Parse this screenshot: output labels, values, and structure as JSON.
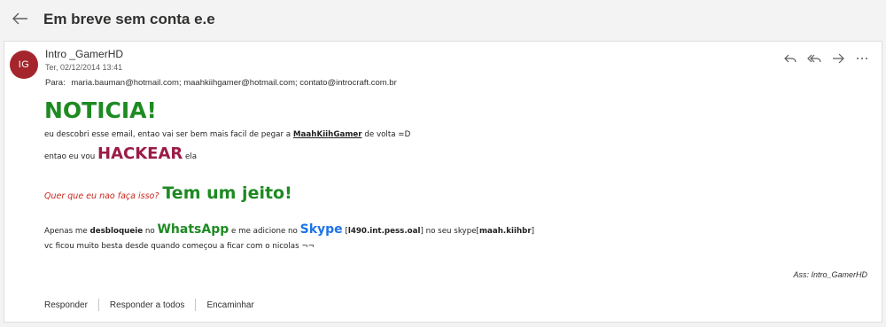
{
  "header": {
    "subject": "Em breve sem conta e.e"
  },
  "message": {
    "avatar_initials": "IG",
    "sender": "Intro _GamerHD",
    "date": "Ter, 02/12/2014 13:41",
    "to_label": "Para:",
    "to_value": "maria.bauman@hotmail.com; maahkiihgamer@hotmail.com; contato@introcraft.com.br"
  },
  "body": {
    "noticia": "NOTICIA!",
    "l1a": "eu descobri esse email, entao vai ser bem mais facil de pegar a ",
    "l1b": "MaahKiihGamer",
    "l1c": " de volta =D",
    "l2a": "entao eu vou ",
    "l2b": "HACKEAR",
    "l2c": " ela",
    "q1": "Quer que eu nao faça isso?",
    "q2": "Tem um jeito!",
    "a1": "Apenas me ",
    "a2": "desbloqueie",
    "a3": " no ",
    "a4": "WhatsApp",
    "a5": " e me adicione no ",
    "a6": "Skype",
    "a7": " [",
    "a8": "l490.int.pess.oal",
    "a9": "] no seu skype[",
    "a10": "maah.kiihbr",
    "a11": "]",
    "last": "vc ficou muito besta desde quando começou a ficar com o nicolas ¬¬",
    "signature": "Ass: Intro_GamerHD"
  },
  "footer": {
    "reply": "Responder",
    "reply_all": "Responder a todos",
    "forward": "Encaminhar"
  }
}
